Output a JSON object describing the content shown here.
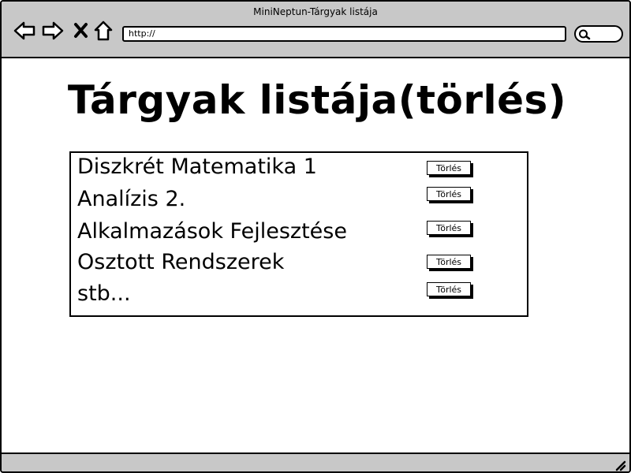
{
  "window": {
    "title": "MiniNeptun-Tárgyak listája",
    "address": "http://"
  },
  "nav_icons": [
    "back-arrow-icon",
    "forward-arrow-icon",
    "close-x-icon",
    "home-icon",
    "search-icon",
    "resize-grip-icon"
  ],
  "page": {
    "title": "Tárgyak listája(törlés)"
  },
  "subjects": [
    {
      "name": "Diszkrét Matematika 1",
      "button": "Törlés"
    },
    {
      "name": "Analízis 2.",
      "button": "Törlés"
    },
    {
      "name": "Alkalmazások Fejlesztése",
      "button": "Törlés"
    },
    {
      "name": "Osztott Rendszerek",
      "button": "Törlés"
    },
    {
      "name": "stb...",
      "button": "Törlés"
    }
  ]
}
